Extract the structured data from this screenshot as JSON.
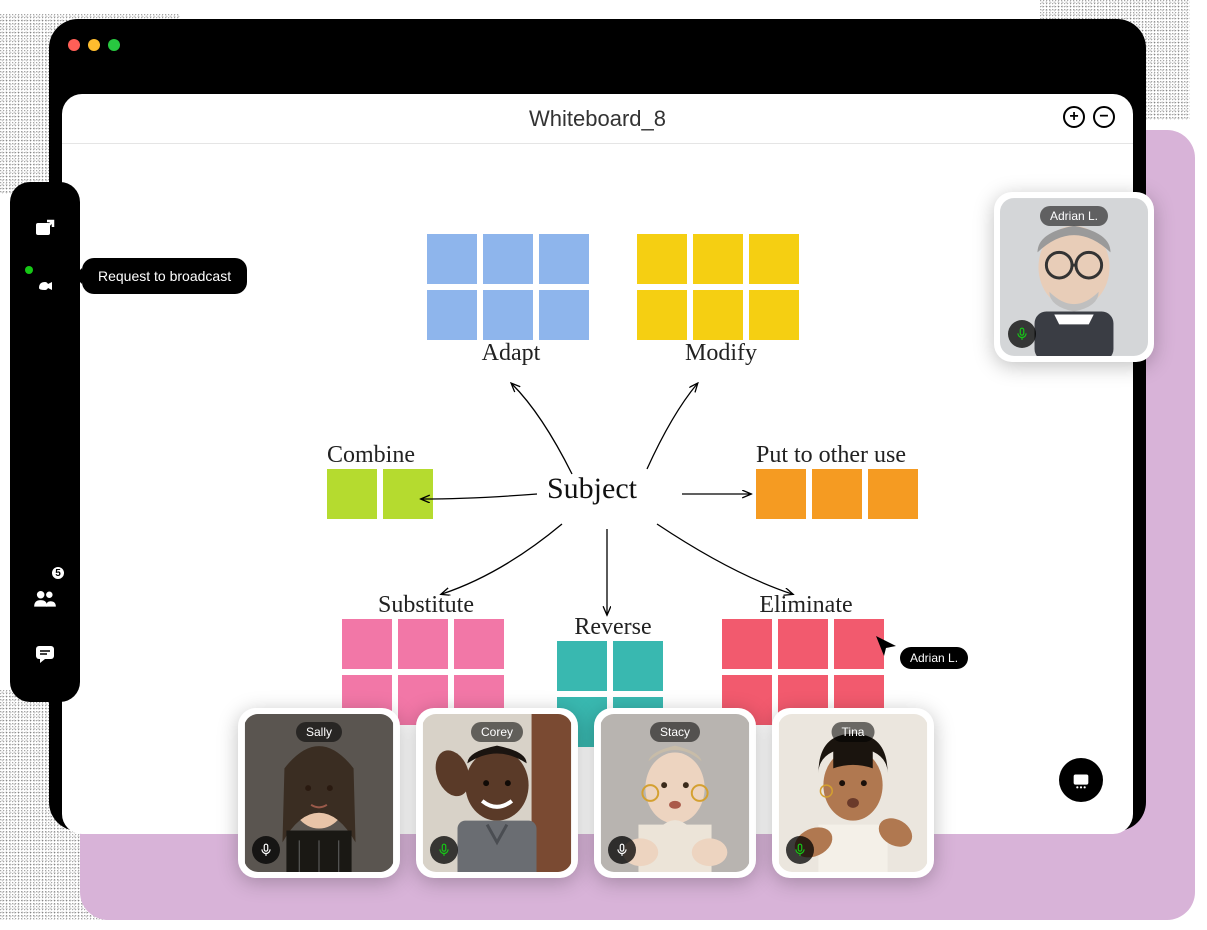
{
  "window_title": "Whiteboard_8",
  "zoom": {
    "in_label": "+",
    "out_label": "−"
  },
  "sidebar": {
    "tooltip": "Request to broadcast",
    "participant_count": "5"
  },
  "board": {
    "center": "Subject",
    "groups": {
      "adapt": "Adapt",
      "modify": "Modify",
      "combine": "Combine",
      "put_other": "Put to other use",
      "substitute": "Substitute",
      "reverse": "Reverse",
      "eliminate": "Eliminate"
    },
    "cursor_user": "Adrian L."
  },
  "participants": {
    "featured": {
      "name": "Adrian L.",
      "mic_color": "#16c716"
    },
    "row": [
      {
        "name": "Sally",
        "mic_color": "#ffffff"
      },
      {
        "name": "Corey",
        "mic_color": "#16c716"
      },
      {
        "name": "Stacy",
        "mic_color": "#ffffff"
      },
      {
        "name": "Tina",
        "mic_color": "#16c716"
      }
    ]
  }
}
